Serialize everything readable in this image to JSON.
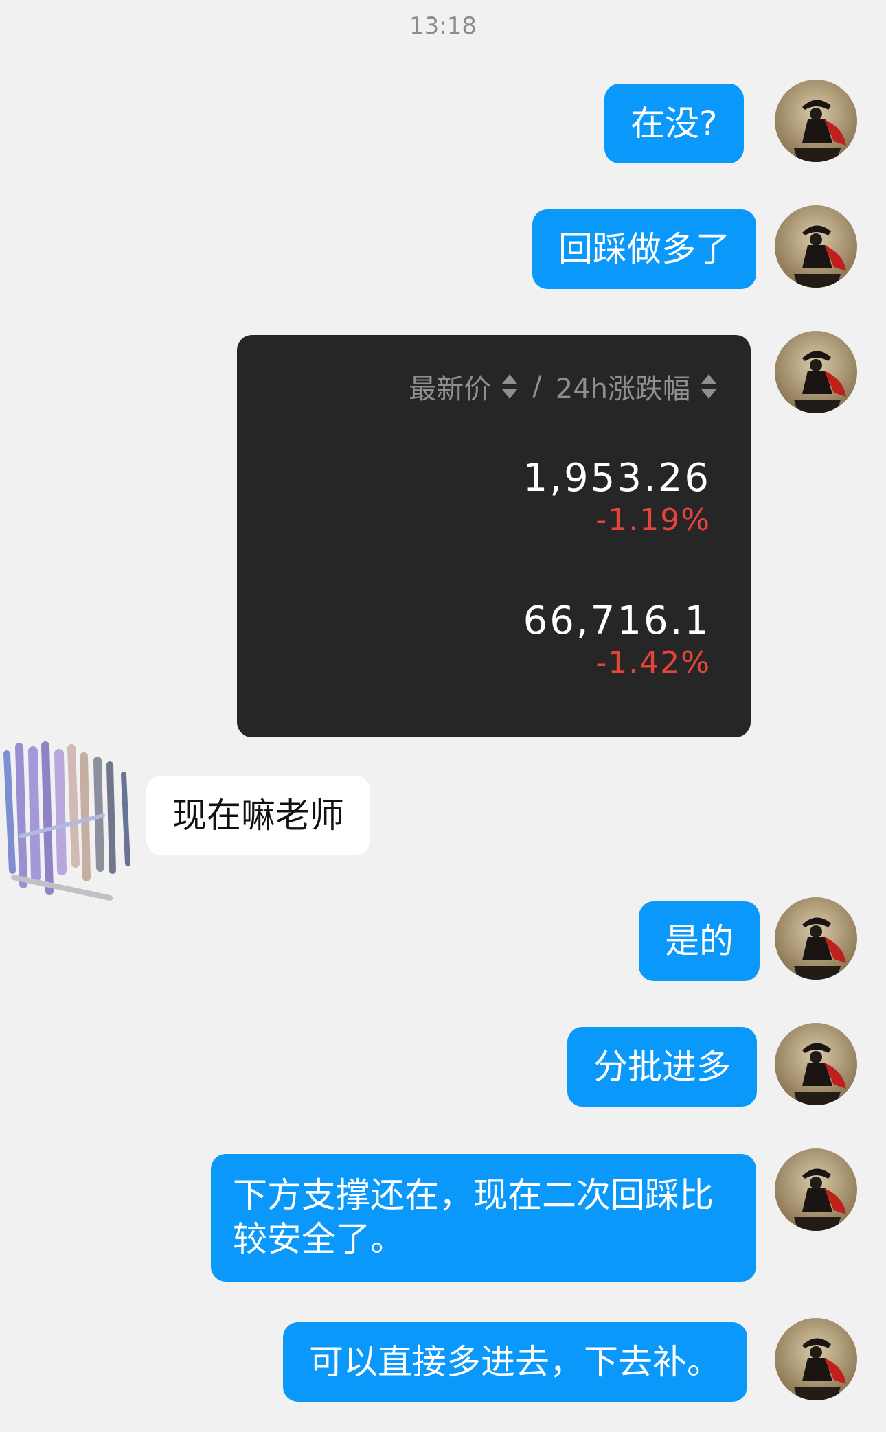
{
  "header": {
    "time": "13:18"
  },
  "messages": [
    {
      "id": "m1",
      "text": "在没?"
    },
    {
      "id": "m2",
      "text": "回踩做多了"
    },
    {
      "id": "m4",
      "text": "现在嘛老师"
    },
    {
      "id": "m5",
      "text": "是的"
    },
    {
      "id": "m6",
      "text": "分批进多"
    },
    {
      "id": "m7",
      "text": "下方支撑还在，现在二次回踩比较安全了。"
    },
    {
      "id": "m8",
      "text": "可以直接多进去，下去补。"
    }
  ],
  "price_card": {
    "col1_label": "最新价",
    "separator": "/",
    "col2_label": "24h涨跌幅",
    "rows": [
      {
        "price": "1,953.26",
        "change": "-1.19%"
      },
      {
        "price": "66,716.1",
        "change": "-1.42%"
      }
    ],
    "down_color": "#e5443d"
  },
  "colors": {
    "outgoing_bubble": "#0a98fa",
    "incoming_bubble": "#ffffff",
    "background": "#f1f1f1"
  }
}
